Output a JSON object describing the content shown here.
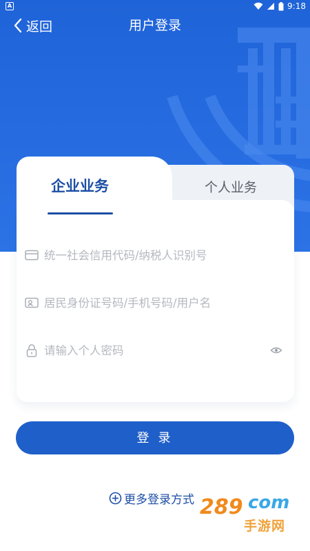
{
  "status_bar": {
    "badge": "A",
    "time": "9:18"
  },
  "nav": {
    "back_label": "返回",
    "title": "用户登录"
  },
  "tabs": [
    {
      "label": "企业业务",
      "active": true
    },
    {
      "label": "个人业务",
      "active": false
    }
  ],
  "form": {
    "credit_code_placeholder": "统一社会信用代码/纳税人识别号",
    "identity_placeholder": "居民身份证号码/手机号码/用户名",
    "password_placeholder": "请输入个人密码"
  },
  "login_button_label": "登 录",
  "more_login_label": "更多登录方式",
  "watermark": {
    "number": "289",
    "domain": "com",
    "subtitle": "手游网"
  },
  "colors": {
    "primary": "#1f5fc9",
    "hero": "#2c73e6",
    "accent_text": "#1c4ea5"
  }
}
